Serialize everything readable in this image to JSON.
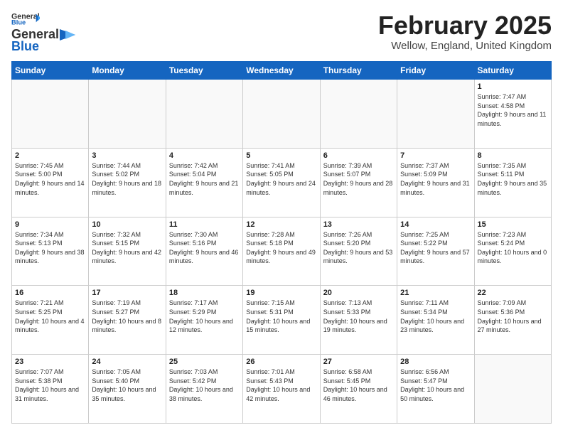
{
  "header": {
    "logo_general": "General",
    "logo_blue": "Blue",
    "title": "February 2025",
    "subtitle": "Wellow, England, United Kingdom"
  },
  "weekdays": [
    "Sunday",
    "Monday",
    "Tuesday",
    "Wednesday",
    "Thursday",
    "Friday",
    "Saturday"
  ],
  "weeks": [
    [
      {
        "day": "",
        "info": ""
      },
      {
        "day": "",
        "info": ""
      },
      {
        "day": "",
        "info": ""
      },
      {
        "day": "",
        "info": ""
      },
      {
        "day": "",
        "info": ""
      },
      {
        "day": "",
        "info": ""
      },
      {
        "day": "1",
        "info": "Sunrise: 7:47 AM\nSunset: 4:58 PM\nDaylight: 9 hours and 11 minutes."
      }
    ],
    [
      {
        "day": "2",
        "info": "Sunrise: 7:45 AM\nSunset: 5:00 PM\nDaylight: 9 hours and 14 minutes."
      },
      {
        "day": "3",
        "info": "Sunrise: 7:44 AM\nSunset: 5:02 PM\nDaylight: 9 hours and 18 minutes."
      },
      {
        "day": "4",
        "info": "Sunrise: 7:42 AM\nSunset: 5:04 PM\nDaylight: 9 hours and 21 minutes."
      },
      {
        "day": "5",
        "info": "Sunrise: 7:41 AM\nSunset: 5:05 PM\nDaylight: 9 hours and 24 minutes."
      },
      {
        "day": "6",
        "info": "Sunrise: 7:39 AM\nSunset: 5:07 PM\nDaylight: 9 hours and 28 minutes."
      },
      {
        "day": "7",
        "info": "Sunrise: 7:37 AM\nSunset: 5:09 PM\nDaylight: 9 hours and 31 minutes."
      },
      {
        "day": "8",
        "info": "Sunrise: 7:35 AM\nSunset: 5:11 PM\nDaylight: 9 hours and 35 minutes."
      }
    ],
    [
      {
        "day": "9",
        "info": "Sunrise: 7:34 AM\nSunset: 5:13 PM\nDaylight: 9 hours and 38 minutes."
      },
      {
        "day": "10",
        "info": "Sunrise: 7:32 AM\nSunset: 5:15 PM\nDaylight: 9 hours and 42 minutes."
      },
      {
        "day": "11",
        "info": "Sunrise: 7:30 AM\nSunset: 5:16 PM\nDaylight: 9 hours and 46 minutes."
      },
      {
        "day": "12",
        "info": "Sunrise: 7:28 AM\nSunset: 5:18 PM\nDaylight: 9 hours and 49 minutes."
      },
      {
        "day": "13",
        "info": "Sunrise: 7:26 AM\nSunset: 5:20 PM\nDaylight: 9 hours and 53 minutes."
      },
      {
        "day": "14",
        "info": "Sunrise: 7:25 AM\nSunset: 5:22 PM\nDaylight: 9 hours and 57 minutes."
      },
      {
        "day": "15",
        "info": "Sunrise: 7:23 AM\nSunset: 5:24 PM\nDaylight: 10 hours and 0 minutes."
      }
    ],
    [
      {
        "day": "16",
        "info": "Sunrise: 7:21 AM\nSunset: 5:25 PM\nDaylight: 10 hours and 4 minutes."
      },
      {
        "day": "17",
        "info": "Sunrise: 7:19 AM\nSunset: 5:27 PM\nDaylight: 10 hours and 8 minutes."
      },
      {
        "day": "18",
        "info": "Sunrise: 7:17 AM\nSunset: 5:29 PM\nDaylight: 10 hours and 12 minutes."
      },
      {
        "day": "19",
        "info": "Sunrise: 7:15 AM\nSunset: 5:31 PM\nDaylight: 10 hours and 15 minutes."
      },
      {
        "day": "20",
        "info": "Sunrise: 7:13 AM\nSunset: 5:33 PM\nDaylight: 10 hours and 19 minutes."
      },
      {
        "day": "21",
        "info": "Sunrise: 7:11 AM\nSunset: 5:34 PM\nDaylight: 10 hours and 23 minutes."
      },
      {
        "day": "22",
        "info": "Sunrise: 7:09 AM\nSunset: 5:36 PM\nDaylight: 10 hours and 27 minutes."
      }
    ],
    [
      {
        "day": "23",
        "info": "Sunrise: 7:07 AM\nSunset: 5:38 PM\nDaylight: 10 hours and 31 minutes."
      },
      {
        "day": "24",
        "info": "Sunrise: 7:05 AM\nSunset: 5:40 PM\nDaylight: 10 hours and 35 minutes."
      },
      {
        "day": "25",
        "info": "Sunrise: 7:03 AM\nSunset: 5:42 PM\nDaylight: 10 hours and 38 minutes."
      },
      {
        "day": "26",
        "info": "Sunrise: 7:01 AM\nSunset: 5:43 PM\nDaylight: 10 hours and 42 minutes."
      },
      {
        "day": "27",
        "info": "Sunrise: 6:58 AM\nSunset: 5:45 PM\nDaylight: 10 hours and 46 minutes."
      },
      {
        "day": "28",
        "info": "Sunrise: 6:56 AM\nSunset: 5:47 PM\nDaylight: 10 hours and 50 minutes."
      },
      {
        "day": "",
        "info": ""
      }
    ]
  ]
}
